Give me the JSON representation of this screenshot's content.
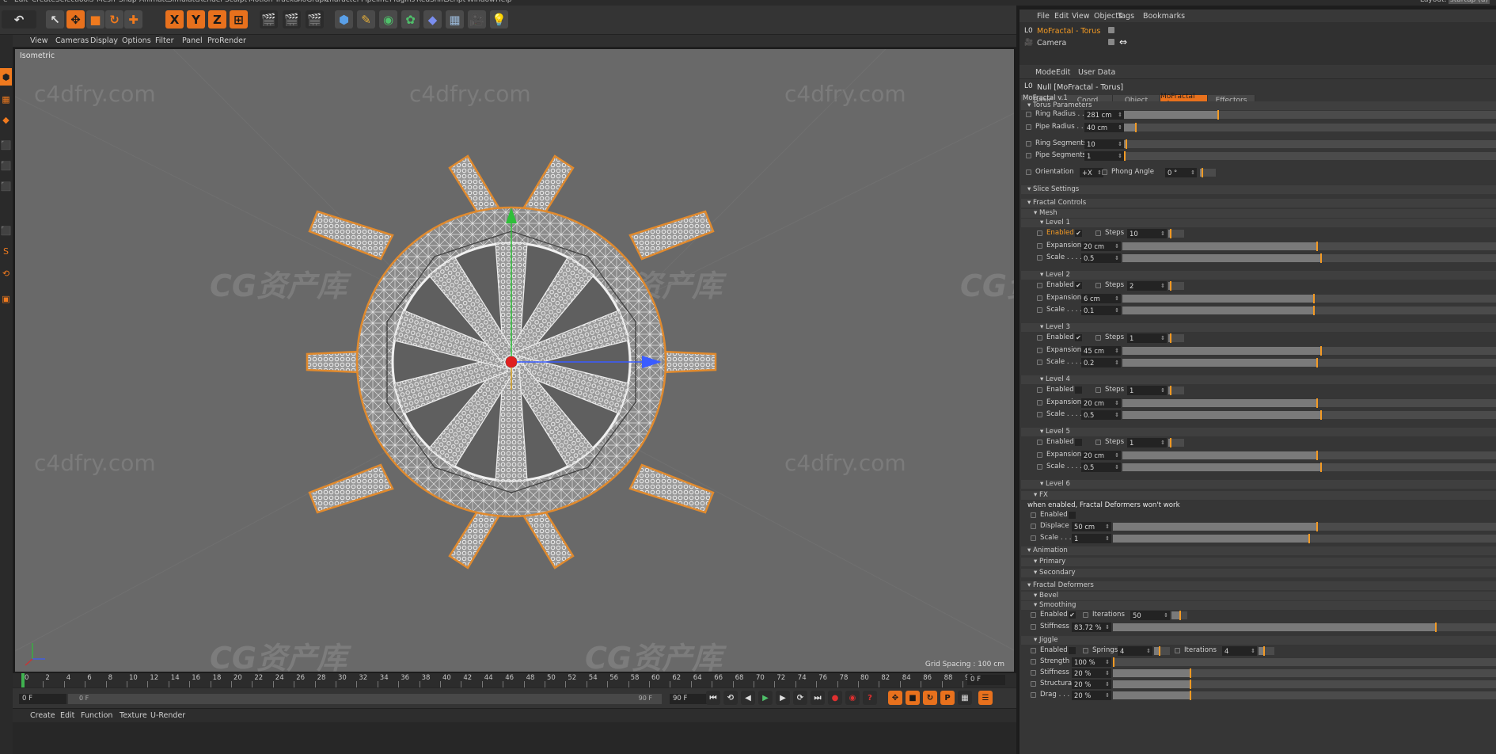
{
  "app": {
    "menubar": [
      "e",
      "Edit",
      "Create",
      "Select",
      "Tools",
      "Mesh",
      "Snap",
      "Animate",
      "Simulate",
      "Render",
      "Sculpt",
      "Motion Tracker",
      "MoGraph",
      "Character",
      "Pipeline",
      "Plugins",
      "RedShift",
      "Script",
      "Window",
      "Help"
    ],
    "layout_label": "Layout:",
    "layout_value": "startup (u)",
    "accent": "#e8711d"
  },
  "toolbar": {
    "icons": [
      "undo-icon",
      "selection-tool-icon",
      "move-icon",
      "scale-icon",
      "rotate-icon",
      "last-tool-icon",
      "x-axis-icon",
      "y-axis-icon",
      "z-axis-icon",
      "coordinate-system-icon",
      "render-view-icon",
      "render-picture-viewer-icon",
      "edit-render-settings-icon",
      "cube-icon",
      "pen-icon",
      "subdivision-icon",
      "mograph-cloner-icon",
      "deformer-icon",
      "floor-icon",
      "camera-icon",
      "light-icon"
    ],
    "axis_labels": [
      "X",
      "Y",
      "Z"
    ]
  },
  "viewport": {
    "menu": [
      "View",
      "Cameras",
      "Display",
      "Options",
      "Filter",
      "Panel",
      "ProRender"
    ],
    "label": "Isometric",
    "grid_spacing": "Grid Spacing : 100 cm",
    "watermarks": [
      "c4dfry.com",
      "c4dfry.com",
      "c4dfry.com",
      "c4dfry.com",
      "c4dfry.com",
      "c4dfry.com",
      "c4dfry.com",
      "c4dfry.com"
    ],
    "cg_watermarks": [
      "CG资产库",
      "CG资产库",
      "CG资产库",
      "CG资产库",
      "CG资产库",
      "CG资产库",
      "CG资产库",
      "CG资产库"
    ]
  },
  "timeline": {
    "ticks": [
      "0",
      "2",
      "4",
      "6",
      "8",
      "10",
      "12",
      "14",
      "16",
      "18",
      "20",
      "22",
      "24",
      "26",
      "28",
      "30",
      "32",
      "34",
      "36",
      "38",
      "40",
      "42",
      "44",
      "46",
      "48",
      "50",
      "52",
      "54",
      "56",
      "58",
      "60",
      "62",
      "64",
      "66",
      "68",
      "70",
      "72",
      "74",
      "76",
      "78",
      "80",
      "82",
      "84",
      "86",
      "88",
      "90"
    ],
    "current_frame": "0 F",
    "start_field": "0 F",
    "start_field2": "0 F",
    "range_end": "90 F",
    "end_field": "90 F"
  },
  "material_manager": {
    "menu": [
      "Create",
      "Edit",
      "Function",
      "Texture",
      "U-Render"
    ]
  },
  "object_manager": {
    "menu": [
      "File",
      "Edit",
      "View",
      "Objects",
      "Tags",
      "Bookmarks"
    ],
    "objects": [
      {
        "name": "MoFractal - Torus",
        "selected": true
      },
      {
        "name": "Camera",
        "selected": false
      }
    ]
  },
  "attributes": {
    "menu": [
      "Mode",
      "Edit",
      "User Data"
    ],
    "title": "Null [MoFractal - Torus]",
    "tabs": [
      "Basic",
      "Coord.",
      "Object",
      "MoFractal v.1",
      "Effectors"
    ],
    "active_tab": "MoFractal v.1",
    "group_title": "MoFractal v.1",
    "torus_header": "Torus Parameters",
    "ring_radius": {
      "label": "Ring Radius . . .",
      "value": "281 cm",
      "level": 0.25
    },
    "pipe_radius": {
      "label": "Pipe Radius . . .",
      "value": "40 cm",
      "level": 0.03
    },
    "ring_segments": {
      "label": "Ring Segments",
      "value": "10",
      "level": 0.005
    },
    "pipe_segments": {
      "label": "Pipe Segments",
      "value": "1",
      "level": 0
    },
    "orientation": {
      "label": "Orientation",
      "value": "+X"
    },
    "phong": {
      "label": "Phong Angle",
      "value": "0 °"
    },
    "slice_header": "Slice Settings",
    "fractal_header": "Fractal Controls",
    "mesh_header": "Mesh",
    "levels": [
      {
        "header": "Level 1",
        "enabled_label": "Enabled",
        "enabled": "✔",
        "steps_label": "Steps",
        "steps": "10",
        "exp_label": "Expansion",
        "expansion": "20 cm",
        "scale_label": "Scale . . . .",
        "scale": "0.5",
        "exp_level": 0.52,
        "scale_level": 0.53,
        "highlight": true
      },
      {
        "header": "Level 2",
        "enabled_label": "Enabled",
        "enabled": "✔",
        "steps_label": "Steps",
        "steps": "2",
        "exp_label": "Expansion",
        "expansion": "6 cm",
        "scale_label": "Scale . . . .",
        "scale": "0.1",
        "exp_level": 0.51,
        "scale_level": 0.51,
        "highlight": false
      },
      {
        "header": "Level 3",
        "enabled_label": "Enabled",
        "enabled": "✔",
        "steps_label": "Steps",
        "steps": "1",
        "exp_label": "Expansion",
        "expansion": "45 cm",
        "scale_label": "Scale . . . .",
        "scale": "0.2",
        "exp_level": 0.53,
        "scale_level": 0.52,
        "highlight": false
      },
      {
        "header": "Level 4",
        "enabled_label": "Enabled",
        "enabled": "",
        "steps_label": "Steps",
        "steps": "1",
        "exp_label": "Expansion",
        "expansion": "20 cm",
        "scale_label": "Scale . . . .",
        "scale": "0.5",
        "exp_level": 0.52,
        "scale_level": 0.53,
        "highlight": false
      },
      {
        "header": "Level 5",
        "enabled_label": "Enabled",
        "enabled": "",
        "steps_label": "Steps",
        "steps": "1",
        "exp_label": "Expansion",
        "expansion": "20 cm",
        "scale_label": "Scale . . . .",
        "scale": "0.5",
        "exp_level": 0.52,
        "scale_level": 0.53,
        "highlight": false
      }
    ],
    "level6_header": "Level 6",
    "fx_header": "FX",
    "fx_note": "when enabled, Fractal Deformers won't work",
    "fx_enabled": {
      "label": "Enabled",
      "value": ""
    },
    "fx_displace": {
      "label": "Displace",
      "value": "50 cm",
      "level": 0.53
    },
    "fx_scale": {
      "label": "Scale . . .",
      "value": "1",
      "level": 0.51
    },
    "animation_header": "Animation",
    "primary_header": "Primary",
    "secondary_header": "Secondary",
    "deformers_header": "Fractal Deformers",
    "bevel_header": "Bevel",
    "smoothing_header": "Smoothing",
    "smooth_enabled": {
      "label": "Enabled",
      "value": "✔"
    },
    "smooth_iterations": {
      "label": "Iterations",
      "value": "50"
    },
    "smooth_stiffness": {
      "label": "Stiffness",
      "value": "83.72 %",
      "level": 0.84
    },
    "jiggle_header": "Jiggle",
    "jiggle_enabled": {
      "label": "Enabled",
      "value": ""
    },
    "jiggle_springs": {
      "label": "Springs",
      "value": "4"
    },
    "jiggle_iterations": {
      "label": "Iterations",
      "value": "4"
    },
    "jiggle_strength": {
      "label": "Strength",
      "value": "100 %",
      "level": 0
    },
    "jiggle_stiffness": {
      "label": "Stiffness",
      "value": "20 %",
      "level": 0.2
    },
    "jiggle_structural": {
      "label": "Structural",
      "value": "20 %",
      "level": 0.2
    },
    "jiggle_drag": {
      "label": "Drag . . . .",
      "value": "20 %",
      "level": 0.2
    }
  }
}
